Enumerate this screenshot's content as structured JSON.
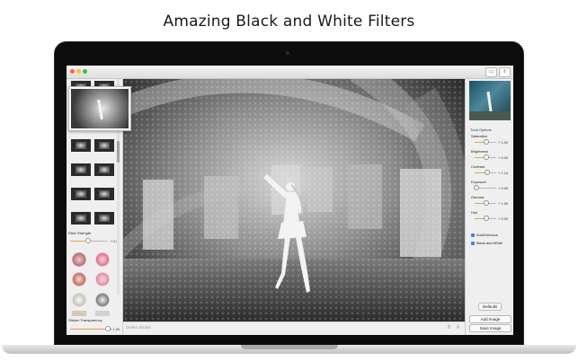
{
  "headline": "Amazing Black and White Filters",
  "window": {
    "traffic_lights": [
      "#ff5f57",
      "#febc2e",
      "#28c840"
    ]
  },
  "left_panel": {
    "filter_strength_label": "Filter Strength",
    "filter_strength_value": "+ 0.45",
    "filter_strength_fraction": 0.45,
    "sticker_transparency_label": "Sticker Transparency",
    "sticker_transparency_value": "+ 1.00",
    "sticker_transparency_fraction": 1.0
  },
  "bottom_bar": {
    "delete_label": "Delete Sticker"
  },
  "right_panel": {
    "section_title": "Tune Options",
    "sliders": [
      {
        "label": "Saturation",
        "value": "+ 1.00",
        "fraction": 0.5
      },
      {
        "label": "Brightness",
        "value": "+ 0.00",
        "fraction": 0.5
      },
      {
        "label": "Contrast",
        "value": "+ 1.14",
        "fraction": 0.55
      },
      {
        "label": "Exposure",
        "value": "+ 0.00",
        "fraction": 0.05
      },
      {
        "label": "Gamma",
        "value": "+ 1.00",
        "fraction": 0.5
      },
      {
        "label": "Hue",
        "value": "+ 0.00",
        "fraction": 0.5
      }
    ],
    "checkboxes": [
      {
        "label": "AutoEnhance",
        "checked": true
      },
      {
        "label": "Black and White",
        "checked": true
      }
    ],
    "defaults_label": "Defaults",
    "add_image_label": "Add Image",
    "save_image_label": "Save Image"
  }
}
